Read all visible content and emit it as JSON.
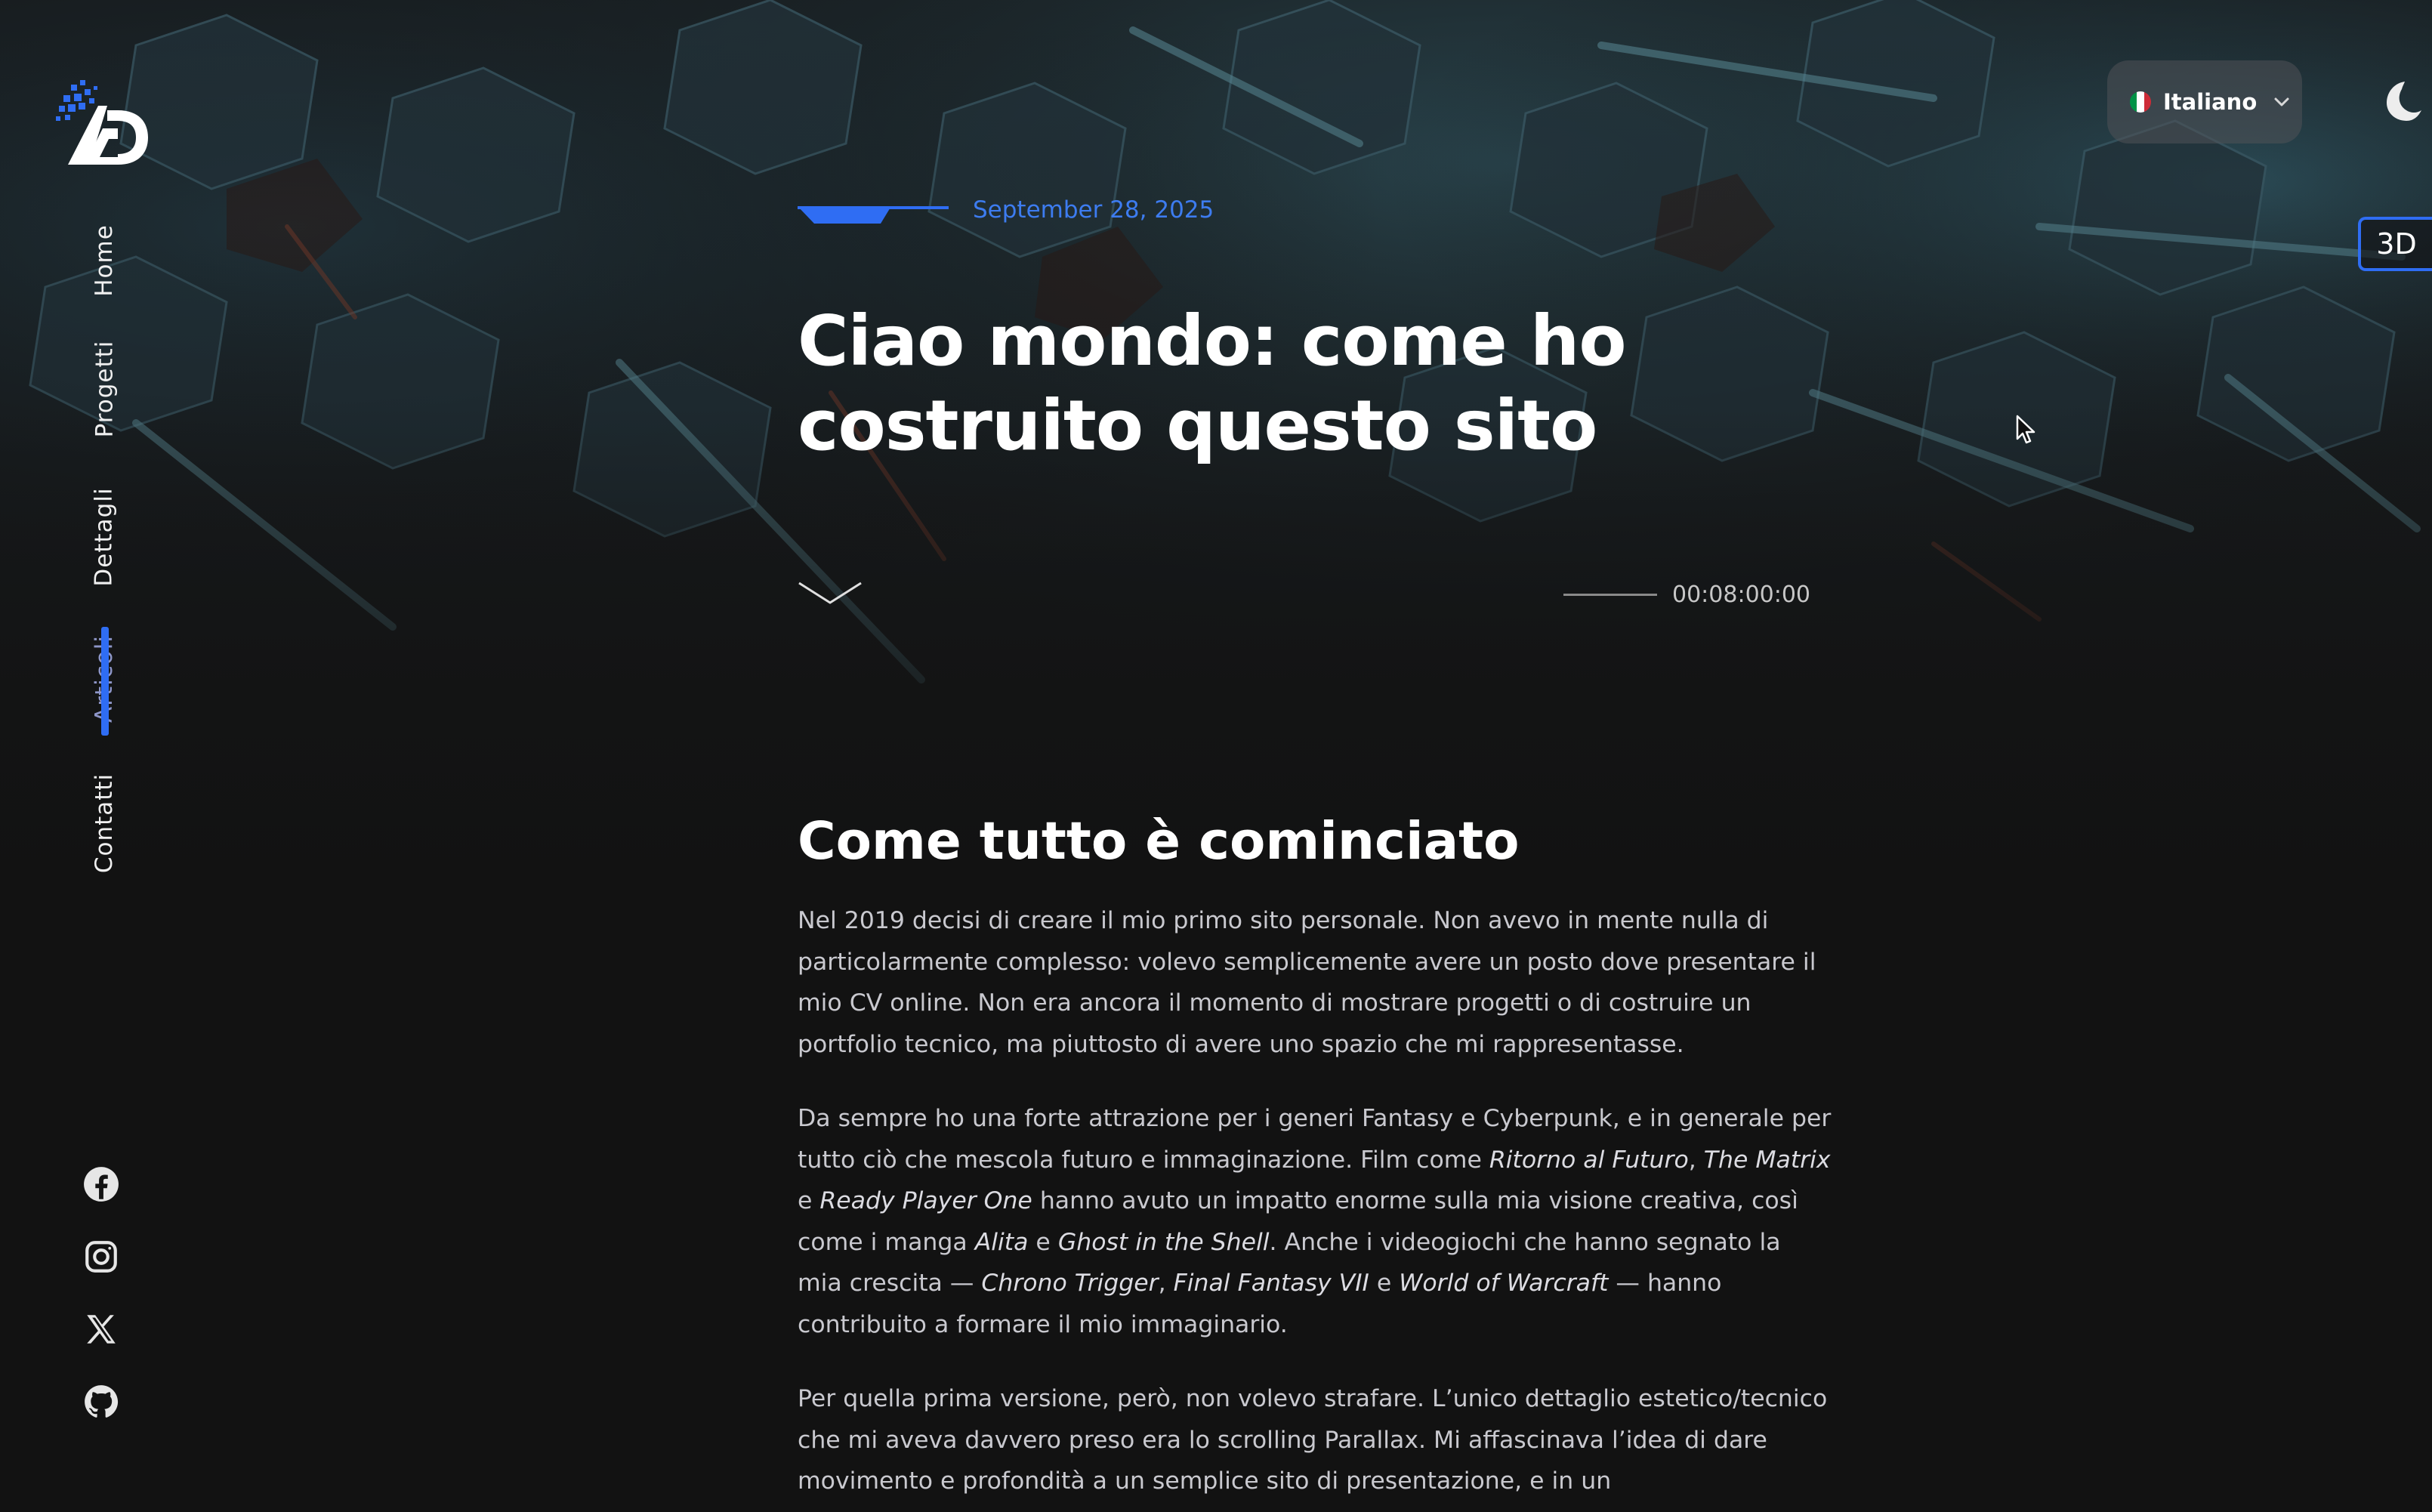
{
  "nav": {
    "items": [
      {
        "label": "Home"
      },
      {
        "label": "Progetti"
      },
      {
        "label": "Dettagli"
      },
      {
        "label": "Articoli",
        "active": true
      },
      {
        "label": "Contatti"
      }
    ]
  },
  "socials": [
    "facebook-icon",
    "instagram-icon",
    "x-icon",
    "github-icon"
  ],
  "language": {
    "label": "Italiano",
    "flag_colors": [
      "#009246",
      "#ffffff",
      "#ce2b37"
    ]
  },
  "theme_toggle": "moon-icon",
  "mode_button": {
    "label": "3D"
  },
  "article": {
    "date": "September 28, 2025",
    "title": "Ciao mondo: come ho costruito questo sito",
    "read_time": "00:08:00:00",
    "section_heading": "Come tutto è cominciato",
    "p1": "Nel 2019 decisi di creare il mio primo sito personale. Non avevo in mente nulla di particolarmente complesso: volevo semplicemente avere un posto dove presentare il mio CV online. Non era ancora il momento di mostrare progetti o di costruire un portfolio tecnico, ma piuttosto di avere uno spazio che mi rappresentasse.",
    "p2_parts": [
      "Da sempre ho una forte attrazione per i generi Fantasy e Cyberpunk, e in generale per tutto ciò che mescola futuro e immaginazione. Film come ",
      "Ritorno al Futuro",
      ", ",
      "The Matrix",
      " e ",
      "Ready Player One",
      " hanno avuto un impatto enorme sulla mia visione creativa, così come i manga ",
      "Alita",
      " e ",
      "Ghost in the Shell",
      ". Anche i videogiochi che hanno segnato la mia crescita — ",
      "Chrono Trigger",
      ", ",
      "Final Fantasy VII",
      " e ",
      "World of Warcraft",
      " — hanno contribuito a formare il mio immaginario."
    ],
    "p3": "Per quella prima versione, però, non volevo strafare. L’unico dettaglio estetico/tecnico che mi aveva davvero preso era lo scrolling Parallax. Mi affascinava l’idea di dare movimento e profondità a un semplice sito di presentazione, e in un"
  },
  "colors": {
    "accent": "#2f6df3",
    "date": "#3d7cf0",
    "background": "#121212"
  }
}
